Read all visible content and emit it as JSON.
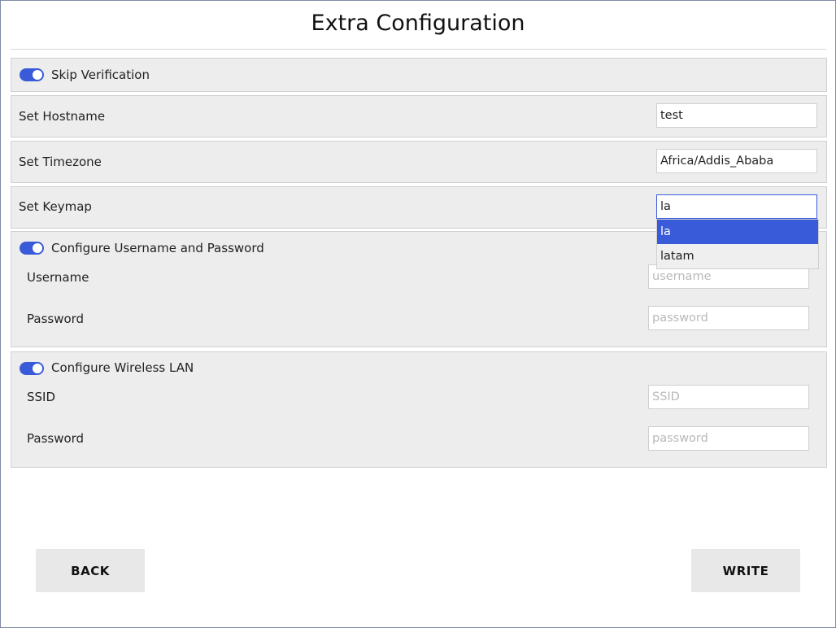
{
  "title": "Extra Configuration",
  "skip_verification": {
    "label": "Skip Verification",
    "enabled": true
  },
  "hostname": {
    "label": "Set Hostname",
    "value": "test"
  },
  "timezone": {
    "label": "Set Timezone",
    "value": "Africa/Addis_Ababa"
  },
  "keymap": {
    "label": "Set Keymap",
    "value": "la",
    "options": [
      "la",
      "latam"
    ],
    "selected_index": 0
  },
  "user_section": {
    "label": "Configure Username and Password",
    "enabled": true,
    "username_label": "Username",
    "username_placeholder": "username",
    "password_label": "Password",
    "password_placeholder": "password"
  },
  "wlan_section": {
    "label": "Configure Wireless LAN",
    "enabled": true,
    "ssid_label": "SSID",
    "ssid_placeholder": "SSID",
    "password_label": "Password",
    "password_placeholder": "password"
  },
  "buttons": {
    "back": "BACK",
    "write": "WRITE"
  },
  "colors": {
    "accent": "#3a5bd9",
    "panel_bg": "#ededed",
    "button_bg": "#e8e8e8"
  }
}
